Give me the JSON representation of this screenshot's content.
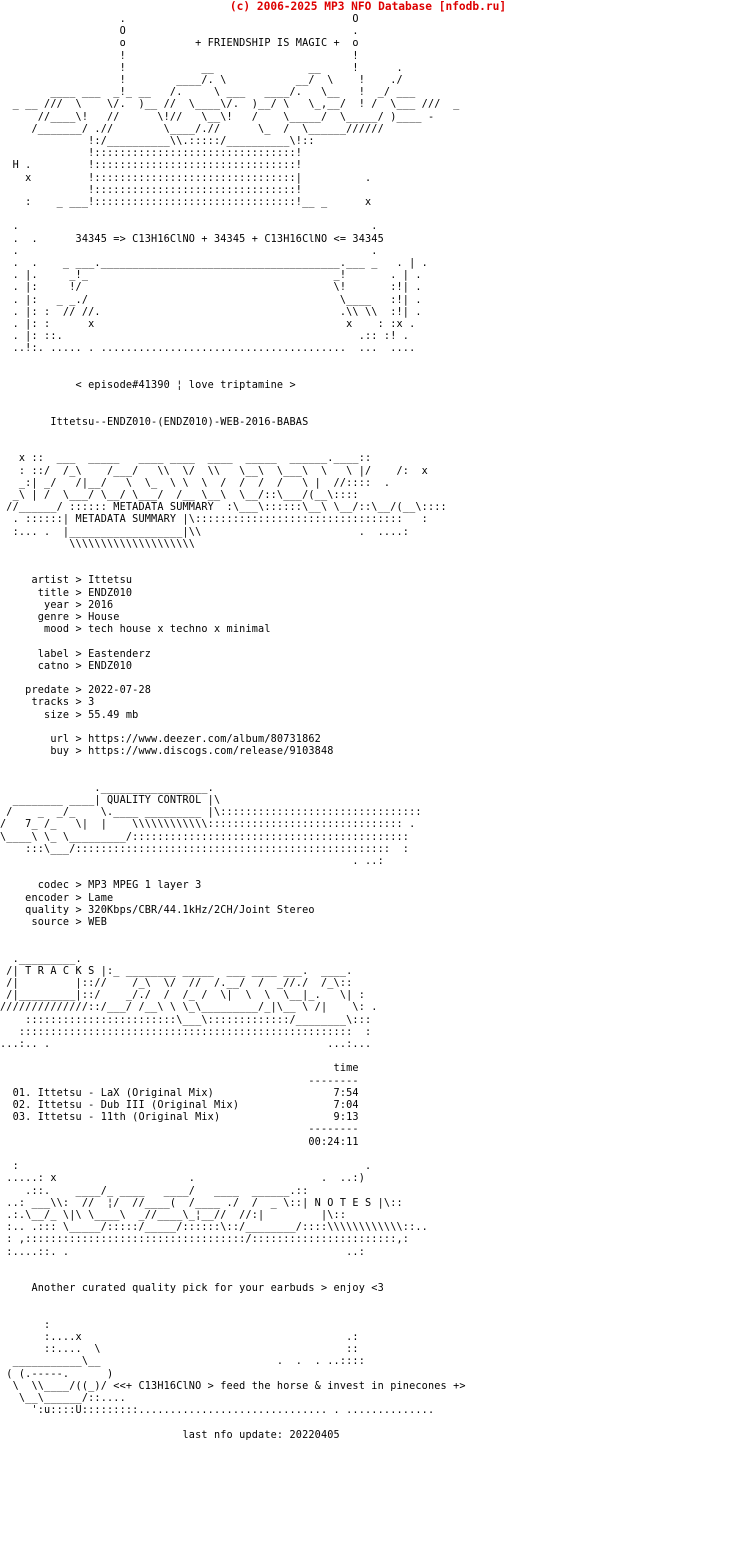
{
  "header": {
    "banner": "(c) 2006-2025 MP3 NFO Database [nfodb.ru]",
    "banner_color": "#dd0000",
    "background_color": "#ffffff",
    "text_color": "#000000"
  },
  "art": {
    "tagline": "+ FRIENDSHIP IS MAGIC +",
    "formula_line": "34345 => C13H16ClNO + 34345 + C13H16ClNO <= 34345",
    "episode_line": "< episode#41390 ¦ love triptamine >",
    "release_name": "Ittetsu--ENDZ010-(ENDZ010)-WEB-2016-BABAS",
    "banner_metadata_label": "METADATA SUMMARY",
    "banner_quality_label": "QUALITY CONTROL",
    "banner_tracks_label": "T R A C K S",
    "banner_notes_label": "N O T E S",
    "header_art": [
      "                   .                                    O",
      "                   O                                    .",
      "                   o           + FRIENDSHIP IS MAGIC +  o",
      "                   !                                    !",
      "                   !           __                   __  !   .",
      "                   !          /. \\              ___/  \\ ! ./",
      "           ____ __!__)__ /  \\_____ )__/  \\___ ./ __/",
      "  _ __ ///  \\    \\/.   //  \\    \\/.  //   \\__/  \\  \\___ ///  _",
      "      //_____\\!  /_____\\! /       \\____/      \\ \\____/ /",
      "     /_______/ .//       \\___/.//   \\_ /  \\_____//",
      "              !:/__________\\\\.:::::/_________\\!::",
      "              !::::::::::::::::::::::::::::::::!",
      "  H .         !::::::::::::::::::::::::::::::::!",
      "    x         !::::::::::::::::::::::::::::::::|        .",
      "              !::::::::::::::::::::::::::::::::!",
      "    :     _ __!::::::::::::::::::::::::::::::::!__ _    x"
    ]
  },
  "metadata": {
    "section_label": "METADATA SUMMARY",
    "fields": [
      {
        "label": "artist",
        "value": "Ittetsu"
      },
      {
        "label": "title",
        "value": "ENDZ010"
      },
      {
        "label": "year",
        "value": "2016"
      },
      {
        "label": "genre",
        "value": "House"
      },
      {
        "label": "mood",
        "value": "tech house x techno x minimal"
      },
      {
        "label": "label",
        "value": "Eastenderz"
      },
      {
        "label": "catno",
        "value": "ENDZ010"
      },
      {
        "label": "predate",
        "value": "2022-07-28"
      },
      {
        "label": "tracks",
        "value": "3"
      },
      {
        "label": "size",
        "value": "55.49 mb"
      },
      {
        "label": "url",
        "value": "https://www.deezer.com/album/80731862"
      },
      {
        "label": "buy",
        "value": "https://www.discogs.com/release/9103848"
      }
    ]
  },
  "quality": {
    "section_label": "QUALITY CONTROL",
    "fields": [
      {
        "label": "codec",
        "value": "MP3 MPEG 1 layer 3"
      },
      {
        "label": "encoder",
        "value": "Lame"
      },
      {
        "label": "quality",
        "value": "320Kbps/CBR/44.1kHz/2CH/Joint Stereo"
      },
      {
        "label": "source",
        "value": "WEB"
      }
    ]
  },
  "tracks": {
    "section_label": "T R A C K S",
    "time_header": "time",
    "rule": "--------",
    "items": [
      {
        "num": "01.",
        "title": "Ittetsu - LaX (Original Mix)",
        "time": "7:54"
      },
      {
        "num": "02.",
        "title": "Ittetsu - Dub III (Original Mix)",
        "time": "7:04"
      },
      {
        "num": "03.",
        "title": "Ittetsu - 11th (Original Mix)",
        "time": "9:13"
      }
    ],
    "total_time": "00:24:11"
  },
  "notes": {
    "section_label": "N O T E S",
    "text": "Another curated quality pick for your earbuds > enjoy <3"
  },
  "footer": {
    "tagline": "<<+ C13H16ClNO > feed the horse & invest in pinecones +>",
    "last_update_label": "last nfo update:",
    "last_update_value": "20220405"
  },
  "body_text": "                   .                                    O\n                   O                                    .\n                   o           + FRIENDSHIP IS MAGIC +  o\n                   !                                    !\n                   !            __               __     !      .\n                   !        ____/. \\           __/  \\    !    ./\n        ____ ___  _!_ __   /.     \\ ___   ____/.   \\__   !  _/ ___\n  _ __ ///  \\    \\/.  )__ //  \\____\\/.  )__/ \\   \\_,__/  ! /  \\___ ///  _\n      //____\\!   //      \\!//   \\__\\!   /    \\_____/  \\_____/ )____ -\n     /_______/ .//        \\____/.//      \\_  /  \\______//////\n              !:/__________\\\\.:::::/__________\\!::\n              !::::::::::::::::::::::::::::::::!\n  H .         !::::::::::::::::::::::::::::::::!\n    x         !::::::::::::::::::::::::::::::::|          .\n              !::::::::::::::::::::::::::::::::!\n    :    _ ___!::::::::::::::::::::::::::::::::!__ _      x\n\n  .                                                        .\n  .  .      34345 => C13H16ClNO + 34345 + C13H16ClNO <= 34345\n  .                                                        .\n  .  .    _ ___.______________________________________.___ _   . | .\n  . |.     _!_                                       _!       . | .\n  . |:     !/                                        \\!       :!| .\n  . |:   _ _./                                        \\____   :!| .\n  . |: :  // //.                                      .\\\\ \\\\  :!| .\n  . |: :      x                                        x    : :x .\n  . |: ::.                                               .:: :! .\n  ..!:. ..... . .......................................  ...  ....\n\n\n            < episode#41390 ¦ love triptamine >\n\n\n        Ittetsu--ENDZ010-(ENDZ010)-WEB-2016-BABAS\n\n\n   x ::  ___  _____   ____ ____  ____  _____  ______.____::\n   : ::/  /_\\    /___/   \\\\  \\/  \\\\   \\__\\  \\___\\  \\   \\ |/    /:  x\n   _:| _/   /|__/   \\  \\_  \\ \\  \\  /  /  /  /   \\ |  //::::  .\n  _\\ | /  \\___/ \\__/ \\___/  /__ \\__\\  \\__/::\\___/(__\\::::\n //______/ :::::: METADATA SUMMARY  :\\___\\::::::\\__\\ \\__/::\\__/(__\\::::\n  . ::::::| METADATA SUMMARY |\\:::::::::::::::::::::::::::::::::   :\n  :... .  |__________________|\\\\                         .  ....:\n           \\\\\\\\\\\\\\\\\\\\\\\\\\\\\\\\\\\\\\\\\n\n\n     artist > Ittetsu\n      title > ENDZ010\n       year > 2016\n      genre > House\n       mood > tech house x techno x minimal\n\n      label > Eastenderz\n      catno > ENDZ010\n\n    predate > 2022-07-28\n     tracks > 3\n       size > 55.49 mb\n\n        url > https://www.deezer.com/album/80731862\n        buy > https://www.discogs.com/release/9103848\n\n\n               ._________________.\n  ________ ____| QUALITY CONTROL |\\\n /    _  _/_    \\.____ _________ |\\::::::::::::::::::::::::::::::::\n/   7_ /_   \\|  |    \\\\\\\\\\\\\\\\\\\\\\\\::::::::::::::::::::::::::::::: .\n\\____\\ \\_ \\_________/::::::::::::::::::::::::::::::::::::::::::::\n    :::\\___/::::::::::::::::::::::::::::::::::::::::::::::::::  :\n                                                        . ..:\n\n      codec > MP3 MPEG 1 layer 3\n    encoder > Lame\n    quality > 320Kbps/CBR/44.1kHz/2CH/Joint Stereo\n     source > WEB\n\n\n  ._________.\n /| T R A C K S |:_ ________ _____  ___ ____ ___.  ____.\n /|         |:://    /_\\  \\/  //  /.__/  /  _//./  /_\\::\n /|_________|::/    _/./  /  /_ /  \\|  \\  \\  \\__|_.   \\| :\n//////////////::/___/ /__\\ \\ \\_\\_________/_|\\__ \\ /|    \\: .\n    ::::::::::::::::::::::::\\___\\:::::::::::::/________\\:::\n   :::::::::::::::::::::::::::::::::::::::::::::::::::::  :\n...:.. .                                            ...:...\n\n                                                     time\n                                                 --------\n  01. Ittetsu - LaX (Original Mix)                   7:54\n  02. Ittetsu - Dub III (Original Mix)               7:04\n  03. Ittetsu - 11th (Original Mix)                  9:13\n                                                 --------\n                                                 00:24:11\n\n  :                                                       .\n .....: x                     .                    .  ..:)\n    .::.    ____/_ ____   ____/   ____  ______.::\n ..: ___\\\\:  //  ¦/  //____(  /____ ./  /  _ \\::| N O T E S |\\::\n .:.\\__/_ \\|\\ \\____\\  _//____\\_¦__//  //:|         |\\::\n :.. .::: \\_____/:::::/_____/::::::\\::/________/::::\\\\\\\\\\\\\\\\\\\\\\\\::..\n : ,:::::::::::::::::::::::::::::::::::/:::::::::::::::::::::::,:\n :....::. .                                            ..:\n\n\n     Another curated quality pick for your earbuds > enjoy <3\n\n\n       :\n       :....x                                          .:\n       ::....  \\                                       ::\n  ___________\\__                            .  .  . ..::::\n ( (.-----.      )\n  \\  \\\\____/((_)/ <<+ C13H16ClNO > feed the horse & invest in pinecones +>\n   \\__\\______/::....\n     ':u::::U:::::::::.............................. . ..............\n\n                             last nfo update: 20220405\n"
}
